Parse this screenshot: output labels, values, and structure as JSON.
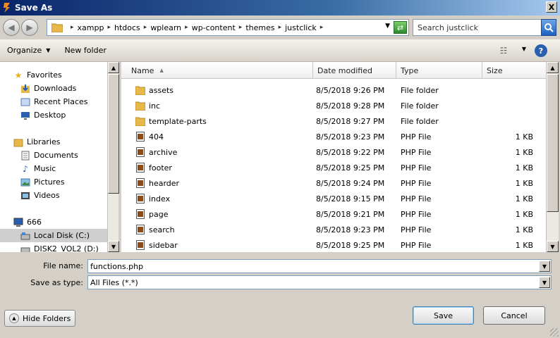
{
  "window": {
    "title": "Save As",
    "close_label": "X"
  },
  "address": {
    "crumbs": [
      "xampp",
      "htdocs",
      "wplearn",
      "wp-content",
      "themes",
      "justclick"
    ],
    "search_placeholder": "Search justclick"
  },
  "toolbar": {
    "organize_label": "Organize",
    "new_folder_label": "New folder"
  },
  "nav": {
    "favorites_label": "Favorites",
    "favorites": [
      "Downloads",
      "Recent Places",
      "Desktop"
    ],
    "libraries_label": "Libraries",
    "libraries": [
      "Documents",
      "Music",
      "Pictures",
      "Videos"
    ],
    "computer_label": "666",
    "drives": [
      "Local Disk (C:)",
      "DISK2_VOL2 (D:)"
    ]
  },
  "columns": {
    "name": "Name",
    "date": "Date modified",
    "type": "Type",
    "size": "Size"
  },
  "files": [
    {
      "name": "assets",
      "date": "8/5/2018 9:26 PM",
      "type": "File folder",
      "size": "",
      "kind": "folder"
    },
    {
      "name": "inc",
      "date": "8/5/2018 9:28 PM",
      "type": "File folder",
      "size": "",
      "kind": "folder"
    },
    {
      "name": "template-parts",
      "date": "8/5/2018 9:27 PM",
      "type": "File folder",
      "size": "",
      "kind": "folder"
    },
    {
      "name": "404",
      "date": "8/5/2018 9:23 PM",
      "type": "PHP File",
      "size": "1 KB",
      "kind": "php"
    },
    {
      "name": "archive",
      "date": "8/5/2018 9:22 PM",
      "type": "PHP File",
      "size": "1 KB",
      "kind": "php"
    },
    {
      "name": "footer",
      "date": "8/5/2018 9:25 PM",
      "type": "PHP File",
      "size": "1 KB",
      "kind": "php"
    },
    {
      "name": "hearder",
      "date": "8/5/2018 9:24 PM",
      "type": "PHP File",
      "size": "1 KB",
      "kind": "php"
    },
    {
      "name": "index",
      "date": "8/5/2018 9:15 PM",
      "type": "PHP File",
      "size": "1 KB",
      "kind": "php"
    },
    {
      "name": "page",
      "date": "8/5/2018 9:21 PM",
      "type": "PHP File",
      "size": "1 KB",
      "kind": "php"
    },
    {
      "name": "search",
      "date": "8/5/2018 9:23 PM",
      "type": "PHP File",
      "size": "1 KB",
      "kind": "php"
    },
    {
      "name": "sidebar",
      "date": "8/5/2018 9:25 PM",
      "type": "PHP File",
      "size": "1 KB",
      "kind": "php"
    }
  ],
  "form": {
    "filename_label": "File name:",
    "filename_value": "functions.php",
    "filetype_label": "Save as type:",
    "filetype_value": "All Files (*.*)"
  },
  "buttons": {
    "hide_folders": "Hide Folders",
    "save": "Save",
    "cancel": "Cancel"
  },
  "colors": {
    "title_bar": "#0a246a",
    "folder": "#e8b84a",
    "php": "#8a4a1a"
  }
}
